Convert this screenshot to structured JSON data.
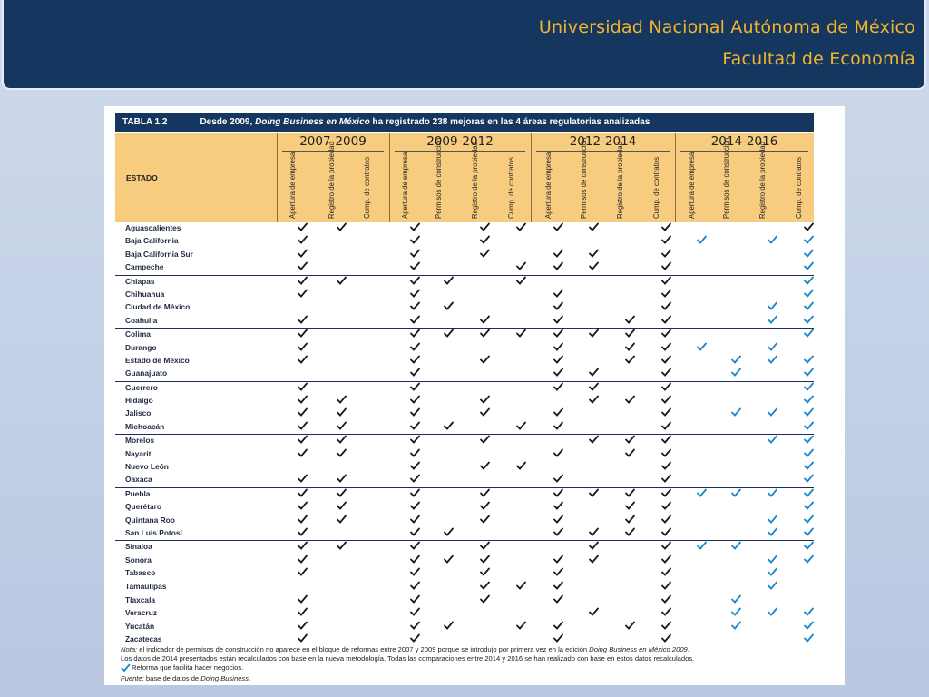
{
  "header": {
    "line1": "Universidad Nacional Autónoma de México",
    "line2": "Facultad de Economía"
  },
  "table": {
    "label": "TABLA 1.2",
    "title_pre": "Desde 2009, ",
    "title_em": "Doing Business en México",
    "title_post": " ha registrado 238 mejoras en las 4 áreas regulatorias analizadas",
    "estado_label": "ESTADO",
    "periods": [
      "2007-2009",
      "2009-2012",
      "2012-2014",
      "2014-2016"
    ],
    "columns": [
      [
        "Apertura de empresa",
        "Registro de la propiedad",
        "Cump. de contratos"
      ],
      [
        "Apertura de empresa",
        "Permisos de construcción",
        "Registro de la propiedad",
        "Cump. de contratos"
      ],
      [
        "Apertura de empresa",
        "Permisos de construcción",
        "Registro de la propiedad",
        "Cump. de contratos"
      ],
      [
        "Apertura de empresa",
        "Permisos de construcción",
        "Registro de la propiedad",
        "Cump. de contratos"
      ]
    ],
    "rows": [
      {
        "name": "Aguascalientes",
        "marks": "110 1011 1101 0001"
      },
      {
        "name": "Baja California",
        "marks": "100 1010 0001 2022"
      },
      {
        "name": "Baja California Sur",
        "marks": "100 1010 1101 0002"
      },
      {
        "name": "Campeche",
        "marks": "100 1001 1101 0002"
      },
      {
        "name": "Chiapas",
        "marks": "110 1101 0001 0002"
      },
      {
        "name": "Chihuahua",
        "marks": "100 1000 1001 0002"
      },
      {
        "name": "Ciudad de México",
        "marks": "000 1100 1001 0022"
      },
      {
        "name": "Coahuila",
        "marks": "100 1010 1011 0022"
      },
      {
        "name": "Colima",
        "marks": "100 1111 1111 0002"
      },
      {
        "name": "Durango",
        "marks": "100 1000 1011 2020"
      },
      {
        "name": "Estado de México",
        "marks": "100 1010 1011 0222"
      },
      {
        "name": "Guanajuato",
        "marks": "000 1000 1101 0202"
      },
      {
        "name": "Guerrero",
        "marks": "100 1000 1101 0002"
      },
      {
        "name": "Hidalgo",
        "marks": "110 1010 0111 0002"
      },
      {
        "name": "Jalisco",
        "marks": "110 1010 1001 0222"
      },
      {
        "name": "Michoacán",
        "marks": "110 1101 1001 0002"
      },
      {
        "name": "Morelos",
        "marks": "110 1010 0111 0022"
      },
      {
        "name": "Nayarit",
        "marks": "110 1000 1011 0002"
      },
      {
        "name": "Nuevo León",
        "marks": "000 1011 0001 0002"
      },
      {
        "name": "Oaxaca",
        "marks": "110 1000 1001 0002"
      },
      {
        "name": "Puebla",
        "marks": "110 1010 1111 2222"
      },
      {
        "name": "Querétaro",
        "marks": "110 1010 1011 0002"
      },
      {
        "name": "Quintana Roo",
        "marks": "110 1010 1011 0022"
      },
      {
        "name": "San Luis Potosí",
        "marks": "100 1100 1111 0022"
      },
      {
        "name": "Sinaloa",
        "marks": "110 1010 0101 2202"
      },
      {
        "name": "Sonora",
        "marks": "100 1110 1101 0022"
      },
      {
        "name": "Tabasco",
        "marks": "100 1010 1001 0020"
      },
      {
        "name": "Tamaulipas",
        "marks": "000 1011 1001 0020"
      },
      {
        "name": "Tlaxcala",
        "marks": "100 1010 1001 0200"
      },
      {
        "name": "Veracruz",
        "marks": "100 1000 0101 0222"
      },
      {
        "name": "Yucatán",
        "marks": "100 1101 1011 0202"
      },
      {
        "name": "Zacatecas",
        "marks": "100 1000 1001 0002"
      }
    ],
    "notes": {
      "n1_label": "Nota:",
      "n1_pre": " el indicador de permisos de construcción no aparece en el bloque de reformas entre 2007 y 2009 porque se introdujo por primera vez en la edición ",
      "n1_em": "Doing Business en México 2009",
      "n1_post": ".",
      "n2": "Los datos de 2014 presentados están recalculados con base en la nueva metodología. Todas las comparaciones entre 2014 y 2016 se han realizado con base en estos datos recalculados.",
      "n3": "Reforma que facilita hacer negocios.",
      "n4_label": "Fuente:",
      "n4_pre": " base de datos de ",
      "n4_em": "Doing Business",
      "n4_post": "."
    }
  },
  "colors": {
    "check_black": "#1a1a1a",
    "check_blue": "#1a86c9",
    "header_bg": "#f7cc7e",
    "title_bar": "#14365f",
    "accent": "#f0b52c"
  }
}
